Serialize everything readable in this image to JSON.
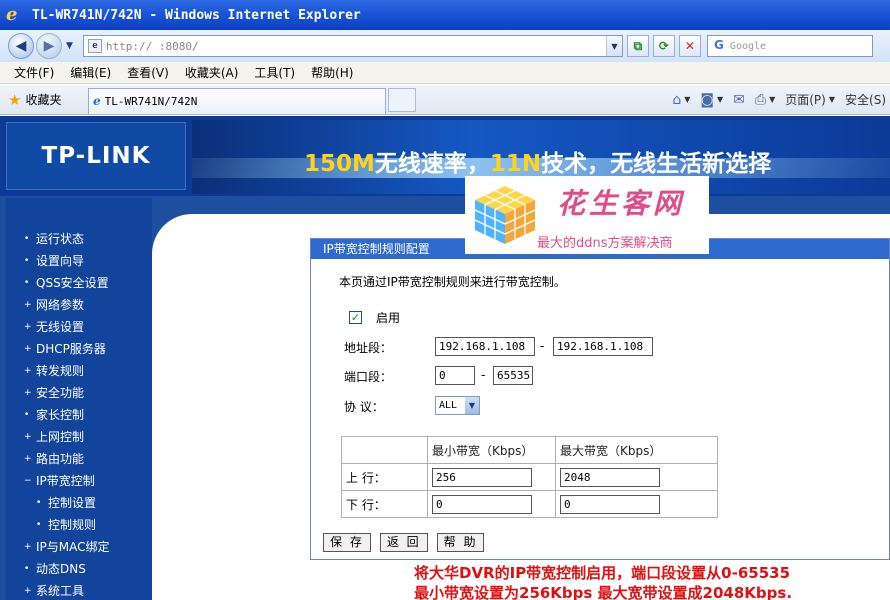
{
  "window": {
    "title": "TL-WR741N/742N - Windows Internet Explorer"
  },
  "address": {
    "url": "http://                :8080/",
    "search_placeholder": "Google"
  },
  "menu": [
    "文件(F)",
    "编辑(E)",
    "查看(V)",
    "收藏夹(A)",
    "工具(T)",
    "帮助(H)"
  ],
  "favorites_label": "收藏夹",
  "tab": {
    "title": "TL-WR741N/742N"
  },
  "commands": {
    "page": "页面(P)",
    "safety": "安全(S)"
  },
  "banner": {
    "logo": "TP-LINK",
    "slogan_a": "150M",
    "slogan_b": "无线速率，",
    "slogan_c": "11N",
    "slogan_d": "技术，无线生活新选择"
  },
  "nav": [
    "运行状态",
    "设置向导",
    "QSS安全设置",
    "网络参数",
    "无线设置",
    "DHCP服务器",
    "转发规则",
    "安全功能",
    "家长控制",
    "上网控制",
    "路由功能",
    "IP带宽控制",
    "控制设置",
    "控制规则",
    "IP与MAC绑定",
    "动态DNS",
    "系统工具"
  ],
  "panel": {
    "header": "IP带宽控制规则配置",
    "description": "本页通过IP带宽控制规则来进行带宽控制。",
    "enable_label": "启用",
    "addr_label": "地址段：",
    "addr_start": "192.168.1.108",
    "addr_end": "192.168.1.108",
    "port_label": "端口段：",
    "port_start": "0",
    "port_end": "65535",
    "protocol_label": "协 议：",
    "protocol_value": "ALL",
    "dash": "-",
    "table": {
      "col_min": "最小带宽（Kbps）",
      "col_max": "最大带宽（Kbps）",
      "up_label": "上 行：",
      "up_min": "256",
      "up_max": "2048",
      "down_label": "下 行：",
      "down_min": "0",
      "down_max": "0"
    },
    "buttons": {
      "save": "保 存",
      "back": "返 回",
      "help": "帮 助"
    }
  },
  "watermark": {
    "title": "花生客网",
    "subtitle": "最大的ddns方案解决商"
  },
  "annotation": {
    "line1": "将大华DVR的IP带宽控制启用，端口段设置从0-65535",
    "line2": "最小带宽设置为256Kbps 最大宽带设置成2048Kbps."
  }
}
